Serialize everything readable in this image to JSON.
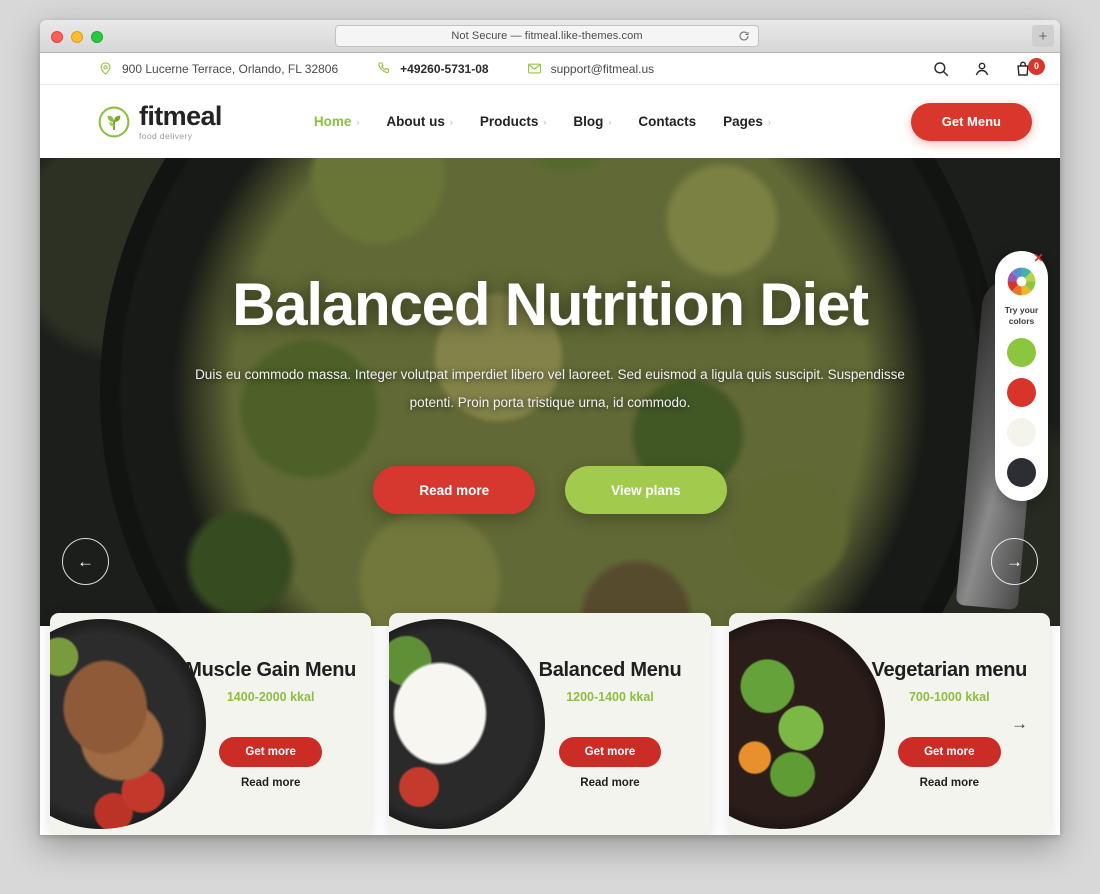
{
  "browser": {
    "url_text": "Not Secure — fitmeal.like-themes.com",
    "reload_icon": "reload-icon",
    "newtab_label": "+",
    "traffic_lights": [
      "close",
      "minimize",
      "zoom"
    ]
  },
  "topbar": {
    "address": "900 Lucerne Terrace, Orlando, FL 32806",
    "phone": "+49260-5731-08",
    "email": "support@fitmeal.us",
    "address_icon": "map-pin-icon",
    "phone_icon": "phone-icon",
    "email_icon": "envelope-icon",
    "search_icon": "search-icon",
    "account_icon": "user-icon",
    "cart_icon": "shopping-bag-icon",
    "cart_count": "0"
  },
  "header": {
    "logo_name": "fitmeal",
    "logo_tagline": "food delivery",
    "logo_icon": "leaf-circle-logo-icon",
    "menu": [
      {
        "label": "Home",
        "caret": "›",
        "active": true
      },
      {
        "label": "About us",
        "caret": "›",
        "active": false
      },
      {
        "label": "Products",
        "caret": "›",
        "active": false
      },
      {
        "label": "Blog",
        "caret": "›",
        "active": false
      },
      {
        "label": "Contacts",
        "caret": "",
        "active": false
      },
      {
        "label": "Pages",
        "caret": "›",
        "active": false
      }
    ],
    "cta_label": "Get Menu"
  },
  "hero": {
    "title": "Balanced Nutrition Diet",
    "description": "Duis eu commodo massa. Integer volutpat imperdiet libero vel laoreet. Sed euismod a ligula quis suscipit. Suspendisse potenti. Proin porta tristique urna, id commodo.",
    "primary_button": "Read more",
    "secondary_button": "View plans",
    "prev_arrow": "←",
    "next_arrow": "→"
  },
  "cards": [
    {
      "title": "Muscle Gain Menu",
      "calories": "1400-2000 kkal",
      "button": "Get more",
      "link": "Read more",
      "photo": "grilled-steak-plate"
    },
    {
      "title": "Balanced Menu",
      "calories": "1200-1400 kkal",
      "button": "Get more",
      "link": "Read more",
      "photo": "rice-plate"
    },
    {
      "title": "Vegetarian menu",
      "calories": "700-1000 kkal",
      "button": "Get more",
      "link": "Read more",
      "photo": "vegetable-bowl"
    }
  ],
  "cards_next_arrow": "→",
  "color_widget": {
    "label": "Try your colors",
    "close_label": "✕",
    "wheel_icon": "color-wheel-icon",
    "swatches": [
      "#8cc63f",
      "#d8342a",
      "#f4f3ec",
      "#2b2f33"
    ]
  },
  "colors": {
    "brand_green": "#8cbf3f",
    "brand_red": "#d9362c",
    "cream": "#f4f4ee",
    "dark": "#232323"
  }
}
